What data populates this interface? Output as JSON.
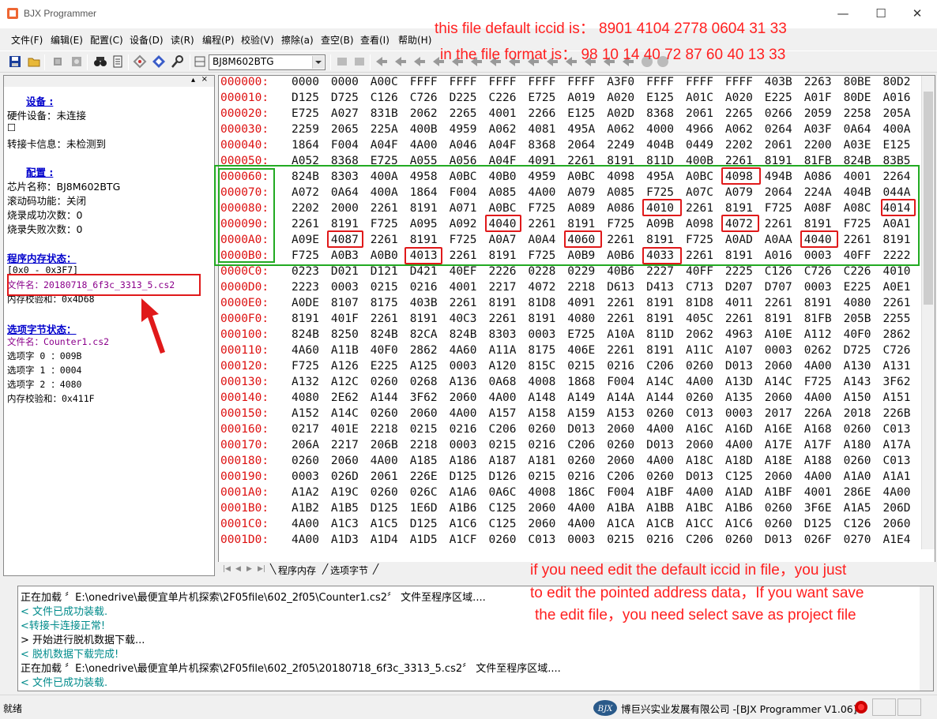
{
  "window": {
    "title": "BJX Programmer",
    "minimize": "—",
    "maximize": "☐",
    "close": "✕"
  },
  "menu": [
    {
      "label": "文件(F)"
    },
    {
      "label": "编辑(E)"
    },
    {
      "label": "配置(C)"
    },
    {
      "label": "设备(D)"
    },
    {
      "label": "读(R)"
    },
    {
      "label": "编程(P)"
    },
    {
      "label": "校验(V)"
    },
    {
      "label": "擦除(a)"
    },
    {
      "label": "查空(B)"
    },
    {
      "label": "查看(I)"
    },
    {
      "label": "帮助(H)"
    }
  ],
  "toolbar": {
    "chip_select": "BJ8M602BTG"
  },
  "left_panel": {
    "device_title": "设备    :",
    "hardware_device": "硬件设备：未连接",
    "checkbox_glyph": "☐",
    "adapter_info": "转接卡信息：未检测到",
    "config_title": "配置    :",
    "chip_name": "芯片名称：BJ8M602BTG",
    "rolling_code": "滚动码功能：关闭",
    "burn_success": "烧录成功次数：0",
    "burn_fail": "烧录失败次数：0",
    "memory_title": "程序内存状态：",
    "range": "[0x0 - 0x3F7]",
    "file_name": "文件名：20180718_6f3c_3313_5.cs2",
    "checksum": "内存校验和：0x4D68",
    "option_title": "选项字节状态：",
    "option_file": "文件名：Counter1.cs2",
    "option0": "选项字 0 ：009B",
    "option1": "选项字 1 ：0004",
    "option2": "选项字 2 ：4080",
    "option_checksum": "内存校验和：0x411F"
  },
  "hex": {
    "rows": [
      {
        "addr": "000000:",
        "cells": [
          "0000",
          "0000",
          "A00C",
          "FFFF",
          "FFFF",
          "FFFF",
          "FFFF",
          "FFFF",
          "A3F0",
          "FFFF",
          "FFFF",
          "FFFF",
          "403B",
          "2263",
          "80BE",
          "80D2"
        ]
      },
      {
        "addr": "000010:",
        "cells": [
          "D125",
          "D725",
          "C126",
          "C726",
          "D225",
          "C226",
          "E725",
          "A019",
          "A020",
          "E125",
          "A01C",
          "A020",
          "E225",
          "A01F",
          "80DE",
          "A016"
        ]
      },
      {
        "addr": "000020:",
        "cells": [
          "E725",
          "A027",
          "831B",
          "2062",
          "2265",
          "4001",
          "2266",
          "E125",
          "A02D",
          "8368",
          "2061",
          "2265",
          "0266",
          "2059",
          "2258",
          "205A"
        ]
      },
      {
        "addr": "000030:",
        "cells": [
          "2259",
          "2065",
          "225A",
          "400B",
          "4959",
          "A062",
          "4081",
          "495A",
          "A062",
          "4000",
          "4966",
          "A062",
          "0264",
          "A03F",
          "0A64",
          "400A"
        ]
      },
      {
        "addr": "000040:",
        "cells": [
          "1864",
          "F004",
          "A04F",
          "4A00",
          "A046",
          "A04F",
          "8368",
          "2064",
          "2249",
          "404B",
          "0449",
          "2202",
          "2061",
          "2200",
          "A03E",
          "E125"
        ]
      },
      {
        "addr": "000050:",
        "cells": [
          "A052",
          "8368",
          "E725",
          "A055",
          "A056",
          "A04F",
          "4091",
          "2261",
          "8191",
          "811D",
          "400B",
          "2261",
          "8191",
          "81FB",
          "824B",
          "83B5"
        ]
      },
      {
        "addr": "000060:",
        "cells": [
          "824B",
          "8303",
          "400A",
          "4958",
          "A0BC",
          "40B0",
          "4959",
          "A0BC",
          "4098",
          "495A",
          "A0BC",
          "4098",
          "494B",
          "A086",
          "4001",
          "2264"
        ]
      },
      {
        "addr": "000070:",
        "cells": [
          "A072",
          "0A64",
          "400A",
          "1864",
          "F004",
          "A085",
          "4A00",
          "A079",
          "A085",
          "F725",
          "A07C",
          "A079",
          "2064",
          "224A",
          "404B",
          "044A"
        ]
      },
      {
        "addr": "000080:",
        "cells": [
          "2202",
          "2000",
          "2261",
          "8191",
          "A071",
          "A0BC",
          "F725",
          "A089",
          "A086",
          "4010",
          "2261",
          "8191",
          "F725",
          "A08F",
          "A08C",
          "4014"
        ]
      },
      {
        "addr": "000090:",
        "cells": [
          "2261",
          "8191",
          "F725",
          "A095",
          "A092",
          "4040",
          "2261",
          "8191",
          "F725",
          "A09B",
          "A098",
          "4072",
          "2261",
          "8191",
          "F725",
          "A0A1"
        ]
      },
      {
        "addr": "0000A0:",
        "cells": [
          "A09E",
          "4087",
          "2261",
          "8191",
          "F725",
          "A0A7",
          "A0A4",
          "4060",
          "2261",
          "8191",
          "F725",
          "A0AD",
          "A0AA",
          "4040",
          "2261",
          "8191"
        ]
      },
      {
        "addr": "0000B0:",
        "cells": [
          "F725",
          "A0B3",
          "A0B0",
          "4013",
          "2261",
          "8191",
          "F725",
          "A0B9",
          "A0B6",
          "4033",
          "2261",
          "8191",
          "A016",
          "0003",
          "40FF",
          "2222"
        ]
      },
      {
        "addr": "0000C0:",
        "cells": [
          "0223",
          "D021",
          "D121",
          "D421",
          "40EF",
          "2226",
          "0228",
          "0229",
          "40B6",
          "2227",
          "40FF",
          "2225",
          "C126",
          "C726",
          "C226",
          "4010"
        ]
      },
      {
        "addr": "0000D0:",
        "cells": [
          "2223",
          "0003",
          "0215",
          "0216",
          "4001",
          "2217",
          "4072",
          "2218",
          "D613",
          "D413",
          "C713",
          "D207",
          "D707",
          "0003",
          "E225",
          "A0E1"
        ]
      },
      {
        "addr": "0000E0:",
        "cells": [
          "A0DE",
          "8107",
          "8175",
          "403B",
          "2261",
          "8191",
          "81D8",
          "4091",
          "2261",
          "8191",
          "81D8",
          "4011",
          "2261",
          "8191",
          "4080",
          "2261"
        ]
      },
      {
        "addr": "0000F0:",
        "cells": [
          "8191",
          "401F",
          "2261",
          "8191",
          "40C3",
          "2261",
          "8191",
          "4080",
          "2261",
          "8191",
          "405C",
          "2261",
          "8191",
          "81FB",
          "205B",
          "2255"
        ]
      },
      {
        "addr": "000100:",
        "cells": [
          "824B",
          "8250",
          "824B",
          "82CA",
          "824B",
          "8303",
          "0003",
          "E725",
          "A10A",
          "811D",
          "2062",
          "4963",
          "A10E",
          "A112",
          "40F0",
          "2862"
        ]
      },
      {
        "addr": "000110:",
        "cells": [
          "4A60",
          "A11B",
          "40F0",
          "2862",
          "4A60",
          "A11A",
          "8175",
          "406E",
          "2261",
          "8191",
          "A11C",
          "A107",
          "0003",
          "0262",
          "D725",
          "C726"
        ]
      },
      {
        "addr": "000120:",
        "cells": [
          "F725",
          "A126",
          "E225",
          "A125",
          "0003",
          "A120",
          "815C",
          "0215",
          "0216",
          "C206",
          "0260",
          "D013",
          "2060",
          "4A00",
          "A130",
          "A131"
        ]
      },
      {
        "addr": "000130:",
        "cells": [
          "A132",
          "A12C",
          "0260",
          "0268",
          "A136",
          "0A68",
          "4008",
          "1868",
          "F004",
          "A14C",
          "4A00",
          "A13D",
          "A14C",
          "F725",
          "A143",
          "3F62"
        ]
      },
      {
        "addr": "000140:",
        "cells": [
          "4080",
          "2E62",
          "A144",
          "3F62",
          "2060",
          "4A00",
          "A148",
          "A149",
          "A14A",
          "A144",
          "0260",
          "A135",
          "2060",
          "4A00",
          "A150",
          "A151"
        ]
      },
      {
        "addr": "000150:",
        "cells": [
          "A152",
          "A14C",
          "0260",
          "2060",
          "4A00",
          "A157",
          "A158",
          "A159",
          "A153",
          "0260",
          "C013",
          "0003",
          "2017",
          "226A",
          "2018",
          "226B"
        ]
      },
      {
        "addr": "000160:",
        "cells": [
          "0217",
          "401E",
          "2218",
          "0215",
          "0216",
          "C206",
          "0260",
          "D013",
          "2060",
          "4A00",
          "A16C",
          "A16D",
          "A16E",
          "A168",
          "0260",
          "C013"
        ]
      },
      {
        "addr": "000170:",
        "cells": [
          "206A",
          "2217",
          "206B",
          "2218",
          "0003",
          "0215",
          "0216",
          "C206",
          "0260",
          "D013",
          "2060",
          "4A00",
          "A17E",
          "A17F",
          "A180",
          "A17A"
        ]
      },
      {
        "addr": "000180:",
        "cells": [
          "0260",
          "2060",
          "4A00",
          "A185",
          "A186",
          "A187",
          "A181",
          "0260",
          "2060",
          "4A00",
          "A18C",
          "A18D",
          "A18E",
          "A188",
          "0260",
          "C013"
        ]
      },
      {
        "addr": "000190:",
        "cells": [
          "0003",
          "026D",
          "2061",
          "226E",
          "D125",
          "D126",
          "0215",
          "0216",
          "C206",
          "0260",
          "D013",
          "C125",
          "2060",
          "4A00",
          "A1A0",
          "A1A1"
        ]
      },
      {
        "addr": "0001A0:",
        "cells": [
          "A1A2",
          "A19C",
          "0260",
          "026C",
          "A1A6",
          "0A6C",
          "4008",
          "186C",
          "F004",
          "A1BF",
          "4A00",
          "A1AD",
          "A1BF",
          "4001",
          "286E",
          "4A00"
        ]
      },
      {
        "addr": "0001B0:",
        "cells": [
          "A1B2",
          "A1B5",
          "D125",
          "1E6D",
          "A1B6",
          "C125",
          "2060",
          "4A00",
          "A1BA",
          "A1BB",
          "A1BC",
          "A1B6",
          "0260",
          "3F6E",
          "A1A5",
          "206D"
        ]
      },
      {
        "addr": "0001C0:",
        "cells": [
          "4A00",
          "A1C3",
          "A1C5",
          "D125",
          "A1C6",
          "C125",
          "2060",
          "4A00",
          "A1CA",
          "A1CB",
          "A1CC",
          "A1C6",
          "0260",
          "D125",
          "C126",
          "2060"
        ]
      },
      {
        "addr": "0001D0:",
        "cells": [
          "4A00",
          "A1D3",
          "A1D4",
          "A1D5",
          "A1CF",
          "0260",
          "C013",
          "0003",
          "0215",
          "0216",
          "C206",
          "0260",
          "D013",
          "026F",
          "0270",
          "A1E4"
        ]
      }
    ]
  },
  "tabs": [
    {
      "label": "程序内存"
    },
    {
      "label": "选项字节"
    }
  ],
  "annotations": {
    "line1": "this file default iccid is： 8901 4104 2778 0604 31 33",
    "line2": "in the file format is： 98 10 14 40 72 87 60 40 13 33",
    "line3": "if you need edit  the default iccid in file，you just",
    "line4": "to edit the pointed address data，If you want save",
    "line5": "the edit file，you need select save as project file"
  },
  "log": [
    {
      "text": "正在加载 〞E:\\onedrive\\最便宜单片机探索\\2F05file\\602_2f05\\Counter1.cs2〞 文件至程序区域....",
      "color": "black"
    },
    {
      "text": "< 文件已成功装载.",
      "color": "teal"
    },
    {
      "text": "<转接卡连接正常!",
      "color": "teal"
    },
    {
      "text": "> 开始进行脱机数据下载...",
      "color": "black"
    },
    {
      "text": "< 脱机数据下载完成!",
      "color": "teal"
    },
    {
      "text": "正在加载 〞E:\\onedrive\\最便宜单片机探索\\2F05file\\602_2f05\\20180718_6f3c_3313_5.cs2〞 文件至程序区域....",
      "color": "black"
    },
    {
      "text": "< 文件已成功装载.",
      "color": "teal"
    }
  ],
  "status": {
    "left": "就绪",
    "company": "博巨兴实业发展有限公司 -[BJX Programmer V1.06]",
    "logo_text": "BJX"
  },
  "colors": {
    "annotation_red": "#ff2020",
    "address_red": "#dd1111",
    "highlight_green": "#22aa22",
    "highlight_red": "#e0191a",
    "section_blue": "#0000cc",
    "file_purple": "#8b008b",
    "log_teal": "#008b8b"
  }
}
